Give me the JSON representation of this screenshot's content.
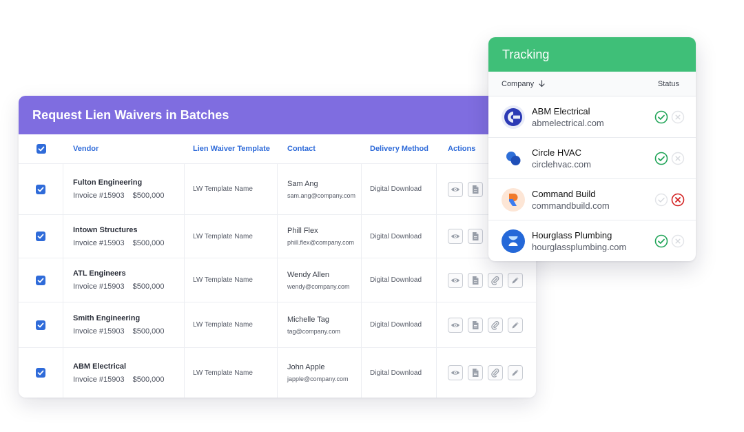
{
  "batch": {
    "title": "Request Lien Waivers in Batches",
    "columns": {
      "vendor": "Vendor",
      "template": "Lien Waiver Template",
      "contact": "Contact",
      "delivery": "Delivery Method",
      "actions": "Actions"
    },
    "rows": [
      {
        "vendor": "Fulton Engineering",
        "invoice": "Invoice #15903",
        "amount": "$500,000",
        "template": "LW Template Name",
        "contact_name": "Sam Ang",
        "contact_email": "sam.ang@company.com",
        "delivery": "Digital Download",
        "checked": true
      },
      {
        "vendor": "Intown Structures",
        "invoice": "Invoice #15903",
        "amount": "$500,000",
        "template": "LW Template Name",
        "contact_name": "Phill Flex",
        "contact_email": "phill.flex@company.com",
        "delivery": "Digital Download",
        "checked": true
      },
      {
        "vendor": "ATL Engineers",
        "invoice": "Invoice #15903",
        "amount": "$500,000",
        "template": "LW Template Name",
        "contact_name": "Wendy Allen",
        "contact_email": "wendy@company.com",
        "delivery": "Digital Download",
        "checked": true
      },
      {
        "vendor": "Smith Engineering",
        "invoice": "Invoice #15903",
        "amount": "$500,000",
        "template": "LW Template Name",
        "contact_name": "Michelle Tag",
        "contact_email": "tag@company.com",
        "delivery": "Digital Download",
        "checked": true
      },
      {
        "vendor": "ABM Electrical",
        "invoice": "Invoice #15903",
        "amount": "$500,000",
        "template": "LW Template Name",
        "contact_name": "John Apple",
        "contact_email": "japple@company.com",
        "delivery": "Digital Download",
        "checked": true
      }
    ],
    "action_icons": [
      "eye-icon",
      "document-icon",
      "paperclip-icon",
      "pencil-icon"
    ],
    "header_color": "#7f6de0",
    "accent_color": "#2f6bd9"
  },
  "tracking": {
    "title": "Tracking",
    "col_company": "Company",
    "col_status": "Status",
    "sort_icon": "arrow-down-icon",
    "header_color": "#3fbf78",
    "rows": [
      {
        "name": "ABM Electrical",
        "url": "abmelectrical.com",
        "logo": "abm-logo",
        "status": "approved"
      },
      {
        "name": "Circle HVAC",
        "url": "circlehvac.com",
        "logo": "circle-logo",
        "status": "approved"
      },
      {
        "name": "Command Build",
        "url": "commandbuild.com",
        "logo": "command-logo",
        "status": "rejected"
      },
      {
        "name": "Hourglass Plumbing",
        "url": "hourglassplumbing.com",
        "logo": "hourglass-logo",
        "status": "approved"
      }
    ]
  }
}
